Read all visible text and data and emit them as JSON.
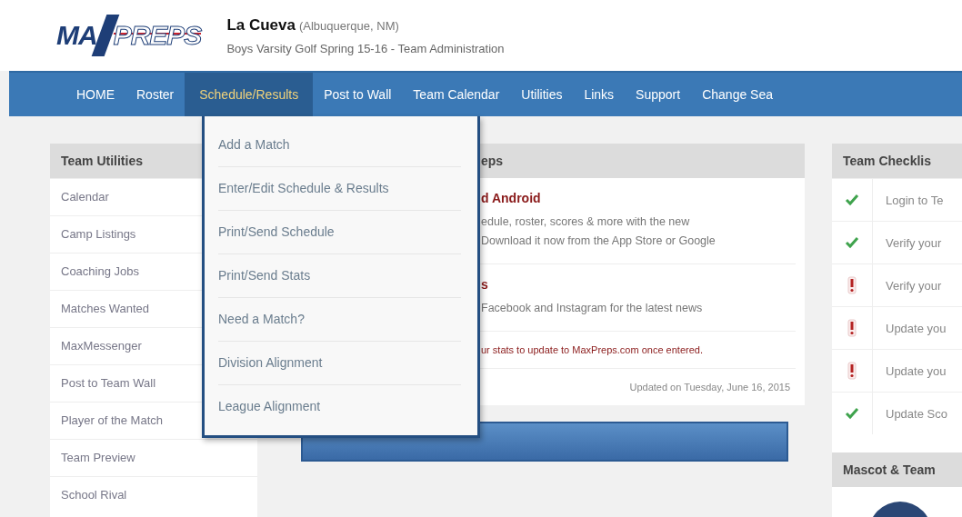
{
  "header": {
    "logo": {
      "left": "MA",
      "right": "PREPS"
    },
    "school": "La Cueva",
    "location": "(Albuquerque, NM)",
    "subtitle": "Boys Varsity Golf Spring 15-16 - Team Administration"
  },
  "nav": [
    {
      "label": "HOME",
      "selected": false
    },
    {
      "label": "Roster",
      "selected": false
    },
    {
      "label": "Schedule/Results",
      "selected": true
    },
    {
      "label": "Post to Wall",
      "selected": false
    },
    {
      "label": "Team Calendar",
      "selected": false
    },
    {
      "label": "Utilities",
      "selected": false
    },
    {
      "label": "Links",
      "selected": false
    },
    {
      "label": "Support",
      "selected": false
    },
    {
      "label": "Change Sea",
      "selected": false
    }
  ],
  "dropdown": [
    "Add a Match",
    "Enter/Edit Schedule & Results",
    "Print/Send Schedule",
    "Print/Send Stats",
    "Need a Match?",
    "Division Alignment",
    "League Alignment"
  ],
  "team_utilities": {
    "title": "Team Utilities",
    "items": [
      "Calendar",
      "Camp Listings",
      "Coaching Jobs",
      "Matches Wanted",
      "MaxMessenger",
      "Post to Team Wall",
      "Player of the Match",
      "Team Preview",
      "School Rival"
    ]
  },
  "news": {
    "title": "eps",
    "items": [
      {
        "heading": "d Android",
        "lines": [
          "edule, roster, scores & more with the new",
          "Download it now from the App Store or Google"
        ]
      },
      {
        "heading": "s",
        "lines": [
          "Facebook and Instagram for the latest news"
        ]
      }
    ],
    "note": "ur stats to update to MaxPreps.com once entered.",
    "updated": "Updated on Tuesday, June 16, 2015"
  },
  "team_checklist": {
    "title": "Team Checklis",
    "items": [
      {
        "label": "Login to Te",
        "done": true
      },
      {
        "label": "Verify your",
        "done": true
      },
      {
        "label": "Verify your",
        "done": false
      },
      {
        "label": "Update you",
        "done": false
      },
      {
        "label": "Update you",
        "done": false
      },
      {
        "label": "Update Sco",
        "done": true
      }
    ]
  },
  "mascot": {
    "title": "Mascot & Team"
  }
}
